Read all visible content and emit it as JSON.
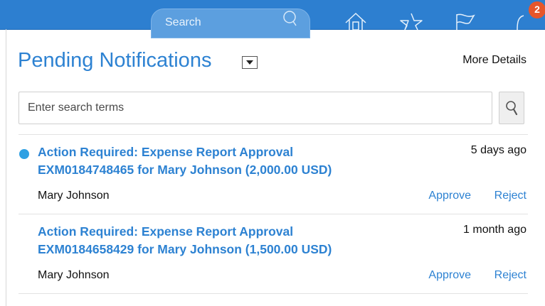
{
  "header": {
    "search_label": "Search",
    "icons": [
      "search-icon",
      "home-icon",
      "star-icon",
      "flag-icon",
      "notifications-icon"
    ],
    "notification_count": "2",
    "accent_color": "#2d7fd0",
    "badge_color": "#e6562b"
  },
  "panel": {
    "title": "Pending Notifications",
    "more_details": "More Details",
    "search_placeholder": "Enter search terms",
    "link_color": "#2d82d2",
    "unread_dot_color": "#2ea0e3"
  },
  "notifications": [
    {
      "title_line1": "Action Required: Expense Report Approval",
      "title_line2": "EXM0184748465 for Mary Johnson (2,000.00 USD)",
      "time": "5 days ago",
      "from": "Mary Johnson",
      "approve": "Approve",
      "reject": "Reject",
      "unread": true
    },
    {
      "title_line1": "Action Required: Expense Report Approval",
      "title_line2": "EXM0184658429 for Mary Johnson (1,500.00 USD)",
      "time": "1 month ago",
      "from": "Mary Johnson",
      "approve": "Approve",
      "reject": "Reject",
      "unread": false
    }
  ]
}
